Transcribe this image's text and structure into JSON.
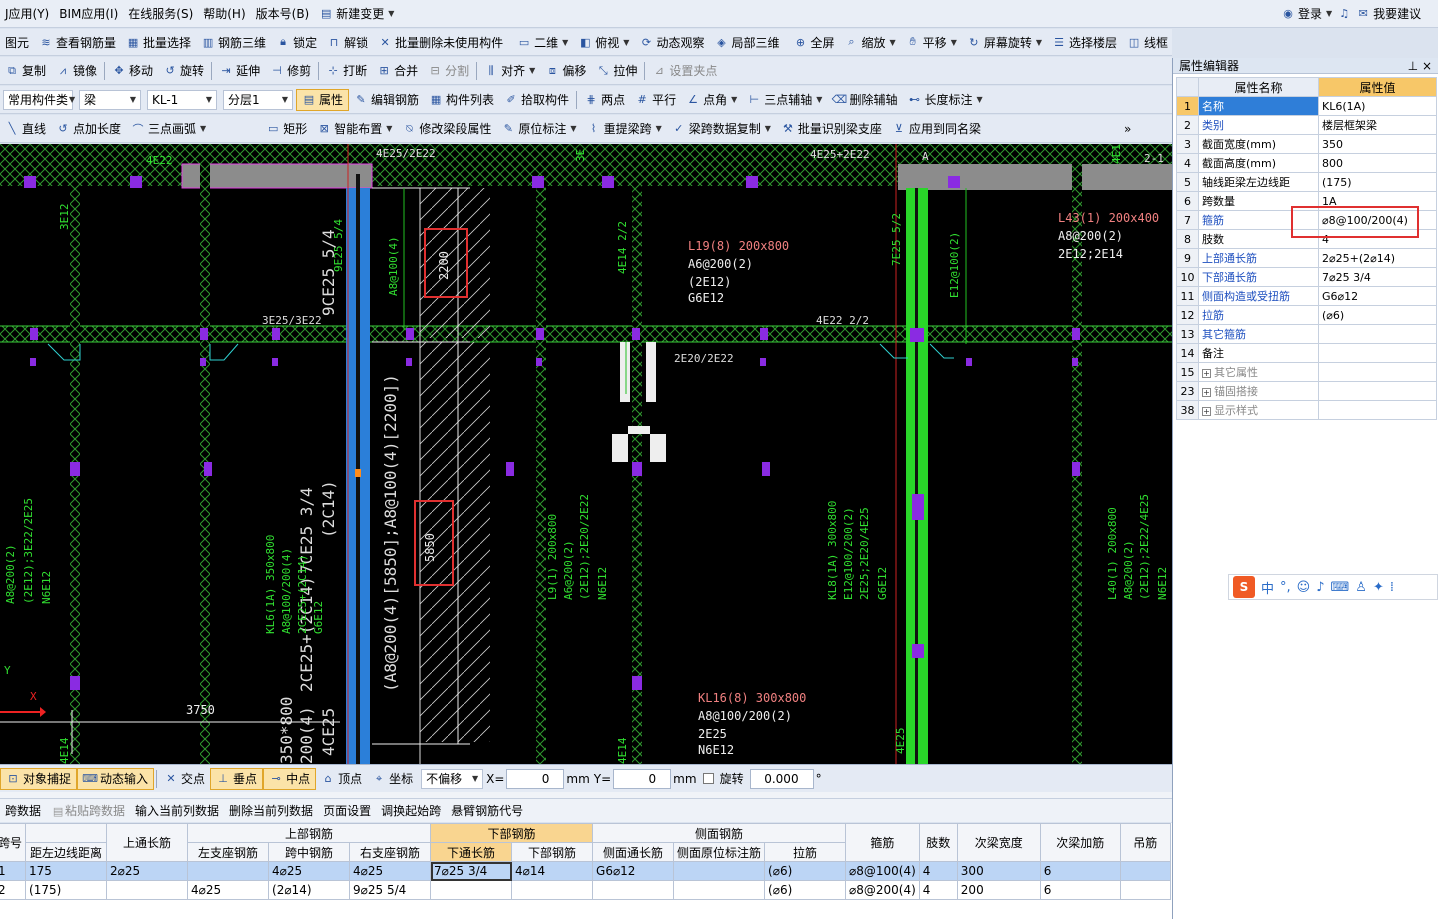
{
  "menubar": {
    "items": [
      "J应用(Y)",
      "BIM应用(I)",
      "在线服务(S)",
      "帮助(H)",
      "版本号(B)",
      "新建变更"
    ],
    "login": "登录",
    "suggest": "我要建议"
  },
  "tb1": [
    "图元",
    "查看钢筋量",
    "批量选择",
    "钢筋三维",
    "锁定",
    "解锁",
    "批量删除未使用构件",
    "二维",
    "俯视",
    "动态观察",
    "局部三维",
    "全屏",
    "缩放",
    "平移",
    "屏幕旋转",
    "选择楼层",
    "线框"
  ],
  "tb2": [
    "复制",
    "镜像",
    "移动",
    "旋转",
    "延伸",
    "修剪",
    "打断",
    "合并",
    "分割",
    "对齐",
    "偏移",
    "拉伸",
    "设置夹点"
  ],
  "tb3": {
    "cat": "常用构件类",
    "type": "梁",
    "comp": "KL-1",
    "floor": "分层1",
    "items": [
      "属性",
      "编辑钢筋",
      "构件列表",
      "拾取构件",
      "两点",
      "平行",
      "点角",
      "三点辅轴",
      "删除辅轴",
      "长度标注"
    ]
  },
  "tb4": [
    "直线",
    "点加长度",
    "三点画弧",
    "矩形",
    "智能布置",
    "修改梁段属性",
    "原位标注",
    "重提梁跨",
    "梁跨数据复制",
    "批量识别梁支座",
    "应用到同名梁"
  ],
  "snap": {
    "items": [
      "对象捕捉",
      "动态输入",
      "交点",
      "垂点",
      "中点",
      "顶点",
      "坐标"
    ],
    "offset_mode": "不偏移",
    "x_label": "X=",
    "x_val": "0",
    "mm1": "mm",
    "y_label": "Y=",
    "y_val": "0",
    "mm2": "mm",
    "rotate": "旋转",
    "rot_val": "0.000",
    "deg": "°"
  },
  "gridtb": [
    "跨数据",
    "粘贴跨数据",
    "输入当前列数据",
    "删除当前列数据",
    "页面设置",
    "调换起始跨",
    "悬臂钢筋代号"
  ],
  "grid": {
    "h_top": [
      "跨号",
      "上通长筋",
      "上部钢筋",
      "下部钢筋",
      "侧面钢筋",
      "箍筋",
      "肢数",
      "次梁宽度",
      "次梁加筋",
      "吊筋"
    ],
    "h_sub": [
      "距左边线距离",
      "左支座钢筋",
      "跨中钢筋",
      "右支座钢筋",
      "下通长筋",
      "下部钢筋",
      "侧面通长筋",
      "侧面原位标注筋",
      "拉筋"
    ],
    "rows": [
      [
        "1",
        "175",
        "2⌀25",
        "",
        "4⌀25",
        "4⌀25",
        "7⌀25 3/4",
        "4⌀14",
        "G6⌀12",
        "",
        "(⌀6)",
        "⌀8@100(4)",
        "4",
        "300",
        "6",
        ""
      ],
      [
        "2",
        "(175)",
        "",
        "4⌀25",
        "(2⌀14)",
        "9⌀25 5/4",
        "",
        "",
        "",
        "",
        "(⌀6)",
        "⌀8@200(4)",
        "4",
        "200",
        "6",
        ""
      ]
    ]
  },
  "prop": {
    "title": "属性编辑器",
    "pin": "⊥ ×",
    "h_name": "属性名称",
    "h_val": "属性值",
    "rows": [
      {
        "i": "1",
        "n": "名称",
        "v": "KL6(1A)"
      },
      {
        "i": "2",
        "n": "类别",
        "v": "楼层框架梁"
      },
      {
        "i": "3",
        "n": "截面宽度(mm)",
        "v": "350"
      },
      {
        "i": "4",
        "n": "截面高度(mm)",
        "v": "800"
      },
      {
        "i": "5",
        "n": "轴线距梁左边线距",
        "v": "(175)"
      },
      {
        "i": "6",
        "n": "跨数量",
        "v": "1A"
      },
      {
        "i": "7",
        "n": "箍筋",
        "v": "⌀8@100/200(4)"
      },
      {
        "i": "8",
        "n": "肢数",
        "v": "4"
      },
      {
        "i": "9",
        "n": "上部通长筋",
        "v": "2⌀25+(2⌀14)"
      },
      {
        "i": "10",
        "n": "下部通长筋",
        "v": "7⌀25 3/4"
      },
      {
        "i": "11",
        "n": "侧面构造或受扭筋",
        "v": "G6⌀12"
      },
      {
        "i": "12",
        "n": "拉筋",
        "v": "(⌀6)"
      },
      {
        "i": "13",
        "n": "其它箍筋",
        "v": ""
      },
      {
        "i": "14",
        "n": "备注",
        "v": ""
      },
      {
        "i": "15",
        "n": "其它属性",
        "v": ""
      },
      {
        "i": "23",
        "n": "锚固搭接",
        "v": ""
      },
      {
        "i": "38",
        "n": "显示样式",
        "v": ""
      }
    ]
  },
  "cad": {
    "t1": "4E22",
    "t2": "4E25/2E22",
    "t3": "4E25+2E22",
    "t4": "3E12",
    "t5": "9E25 5/4",
    "t6": "A8@100(4)",
    "t7": "2200",
    "t8": "4E14 2/2",
    "t9": "7E25 5/2",
    "t10": "E12@100(2)",
    "l19": [
      "L19(8) 200x800",
      "A6@200(2)",
      "(2E12)",
      "G6E12"
    ],
    "l43": [
      "L43(1) 200x400",
      "A8@200(2)",
      "2E12;2E14"
    ],
    "t11": "3E25/3E22",
    "t12": "9CE25 5/4",
    "t13": "4E22 2/2",
    "t14": "2E20/2E22",
    "t15": "(A8@200(4)[5850];A8@100(4)[2200])",
    "t16": "5850",
    "t17": "7CE25 3/4",
    "t18": "(2C14)",
    "t19": "4CE25",
    "t20": "2CE25+(2C14)",
    "kl6": [
      "KL6(1A) 350x800",
      "A8@100/200(4)",
      "2CE25+(2C14)",
      "G6E12"
    ],
    "l9": [
      "L9(1) 200x800",
      "A6@200(2)",
      "(2E12);2E20/2E22",
      "N6E12"
    ],
    "kl8": [
      "KL8(1A) 300x800",
      "E12@100/200(2)",
      "2E25;2E20/4E25",
      "G6E12"
    ],
    "l40": [
      "L40(1) 200x800",
      "A8@200(2)",
      "(2E12);2E22/4E25",
      "N6E12"
    ],
    "kl16": [
      "KL16(8) 300x800",
      "A8@100/200(2)",
      "2E25",
      "N6E12"
    ],
    "left1": [
      "A8@200(2)",
      "(2E12);3E22/2E25",
      "N6E12"
    ],
    "t21": "3750",
    "t22": "350*800",
    "t23": "200(4)",
    "t24": "4E25",
    "t25": "4E14",
    "t26": "A",
    "t27": "3E",
    "t28": "2-1",
    "t29": "4E1",
    "t30": "Y",
    "t31": "X"
  },
  "ime": {
    "lang": "中",
    "punct": "°,"
  }
}
